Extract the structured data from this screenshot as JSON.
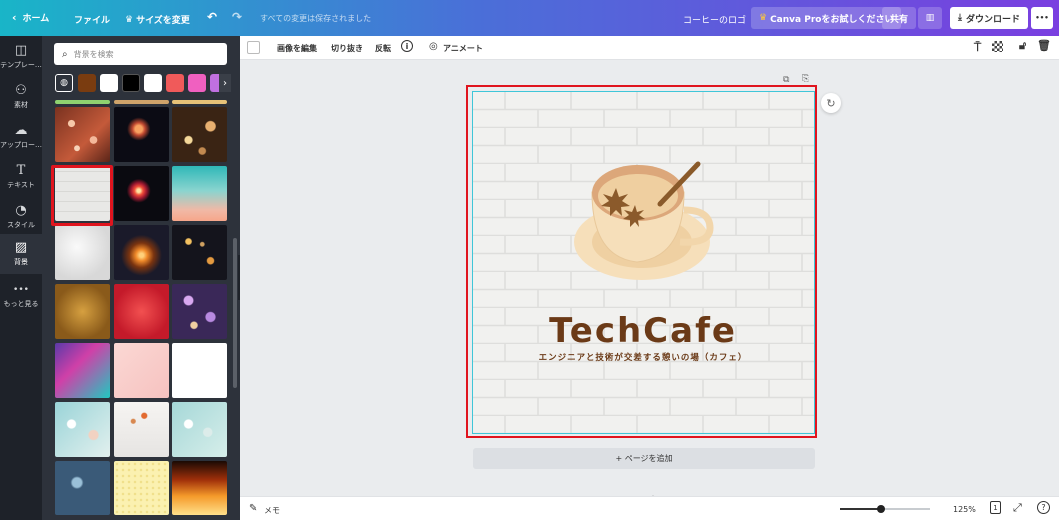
{
  "topbar": {
    "back_label": "ホーム",
    "file_label": "ファイル",
    "resize_label": "サイズを変更",
    "save_status": "すべての変更は保存されました",
    "design_title": "コーヒーのロゴ",
    "try_pro_label": "Canva Proをお試しください",
    "share_label": "共有",
    "download_label": "ダウンロード",
    "more_label": "•••"
  },
  "rail": {
    "items": [
      {
        "label": "テンプレー…",
        "icon": "template-icon"
      },
      {
        "label": "素材",
        "icon": "elements-icon"
      },
      {
        "label": "アップロー…",
        "icon": "upload-icon"
      },
      {
        "label": "テキスト",
        "icon": "text-icon"
      },
      {
        "label": "スタイル",
        "icon": "style-icon"
      },
      {
        "label": "背景",
        "icon": "background-icon"
      },
      {
        "label": "もっと見る",
        "icon": "more-icon"
      }
    ]
  },
  "panel": {
    "search_placeholder": "背景を検索",
    "swatch_colors": [
      "#7a3c10",
      "#ffffff",
      "#000000",
      "#ffffff",
      "#f05a5a",
      "#f060c0",
      "#c070e0"
    ]
  },
  "toolbar": {
    "edit_image": "画像を編集",
    "crop": "切り抜き",
    "flip": "反転",
    "animate": "アニメート"
  },
  "design": {
    "title": "TechCafe",
    "subtitle": "エンジニアと技術が交差する憩いの場（カフェ）"
  },
  "canvas": {
    "add_page": "+ ページを追加"
  },
  "bottombar": {
    "notes_label": "メモ",
    "zoom": "125%",
    "page_count": "1",
    "zoom_fraction": 0.45
  },
  "colors": {
    "accent_red": "#e0141e",
    "selection_cyan": "#3fc6d8",
    "logo_brown": "#6b3a17"
  }
}
